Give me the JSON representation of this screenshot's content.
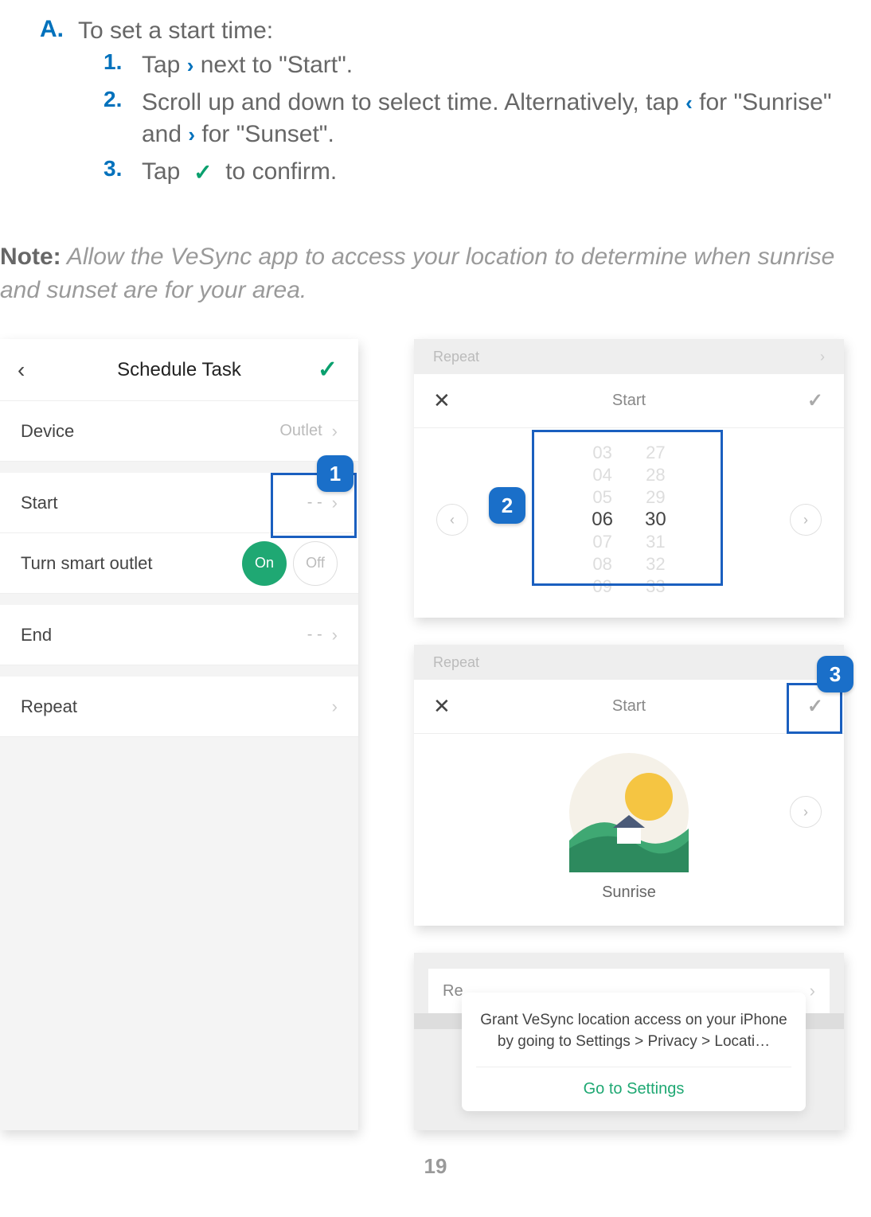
{
  "section": {
    "letter": "A.",
    "title": "To set a start time:",
    "steps": [
      {
        "num": "1.",
        "before": "Tap ",
        "icon": "›",
        "after": " next to \"Start\"."
      },
      {
        "num": "2.",
        "before": "Scroll up and down to select time. Alternatively, tap ",
        "icon1": "‹",
        "mid": " for \"Sunrise\" and ",
        "icon2": "›",
        "after": " for \"Sunset\"."
      },
      {
        "num": "3.",
        "before": "Tap ",
        "icon": "✓",
        "after": " to confirm."
      }
    ]
  },
  "note": {
    "label": "Note:",
    "text": " Allow the VeSync app to access your location to determine when sunrise and sunset are for your area."
  },
  "left_mock": {
    "header_title": "Schedule Task",
    "rows": {
      "device": {
        "label": "Device",
        "value": "Outlet"
      },
      "start": {
        "label": "Start",
        "value": "- -"
      },
      "turn": {
        "label": "Turn smart outlet",
        "on": "On",
        "off": "Off"
      },
      "end": {
        "label": "End",
        "value": "- -"
      },
      "repeat": {
        "label": "Repeat"
      }
    }
  },
  "time_picker": {
    "gray_label": "Repeat",
    "title": "Start",
    "hours": [
      "03",
      "04",
      "05",
      "06",
      "07",
      "08",
      "09"
    ],
    "minutes": [
      "27",
      "28",
      "29",
      "30",
      "31",
      "32",
      "33"
    ],
    "sel_hour_idx": 3,
    "sel_min_idx": 3
  },
  "sunrise": {
    "gray_label": "Repeat",
    "title": "Start",
    "label": "Sunrise"
  },
  "location": {
    "row_label": "Re",
    "modal_text": "Grant VeSync location access on your iPhone by going to Settings > Privacy > Locati…",
    "go": "Go to Settings"
  },
  "callouts": {
    "one": "1",
    "two": "2",
    "three": "3"
  },
  "page": "19"
}
